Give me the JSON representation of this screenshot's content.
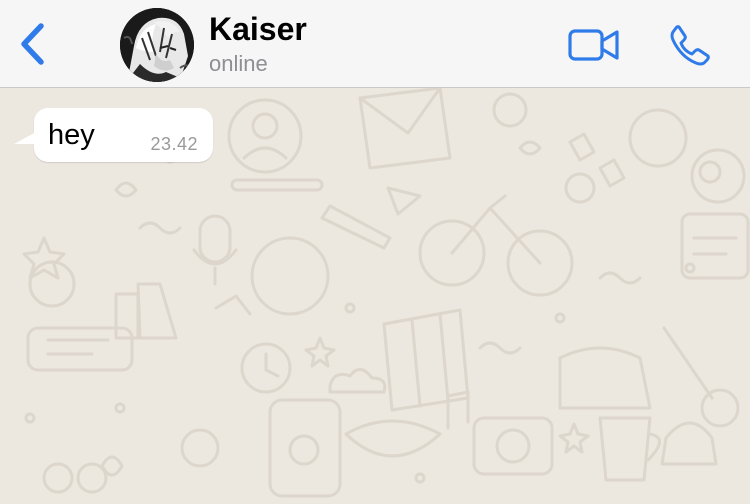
{
  "header": {
    "contact_name": "Kaiser",
    "contact_status": "online",
    "icons": {
      "back": "chevron-left-icon",
      "video": "video-camera-icon",
      "call": "phone-icon"
    },
    "accent_color": "#2f7bea"
  },
  "chat": {
    "messages": [
      {
        "direction": "incoming",
        "text": "hey",
        "time": "23.42"
      }
    ],
    "wallpaper_color": "#ece7df"
  }
}
